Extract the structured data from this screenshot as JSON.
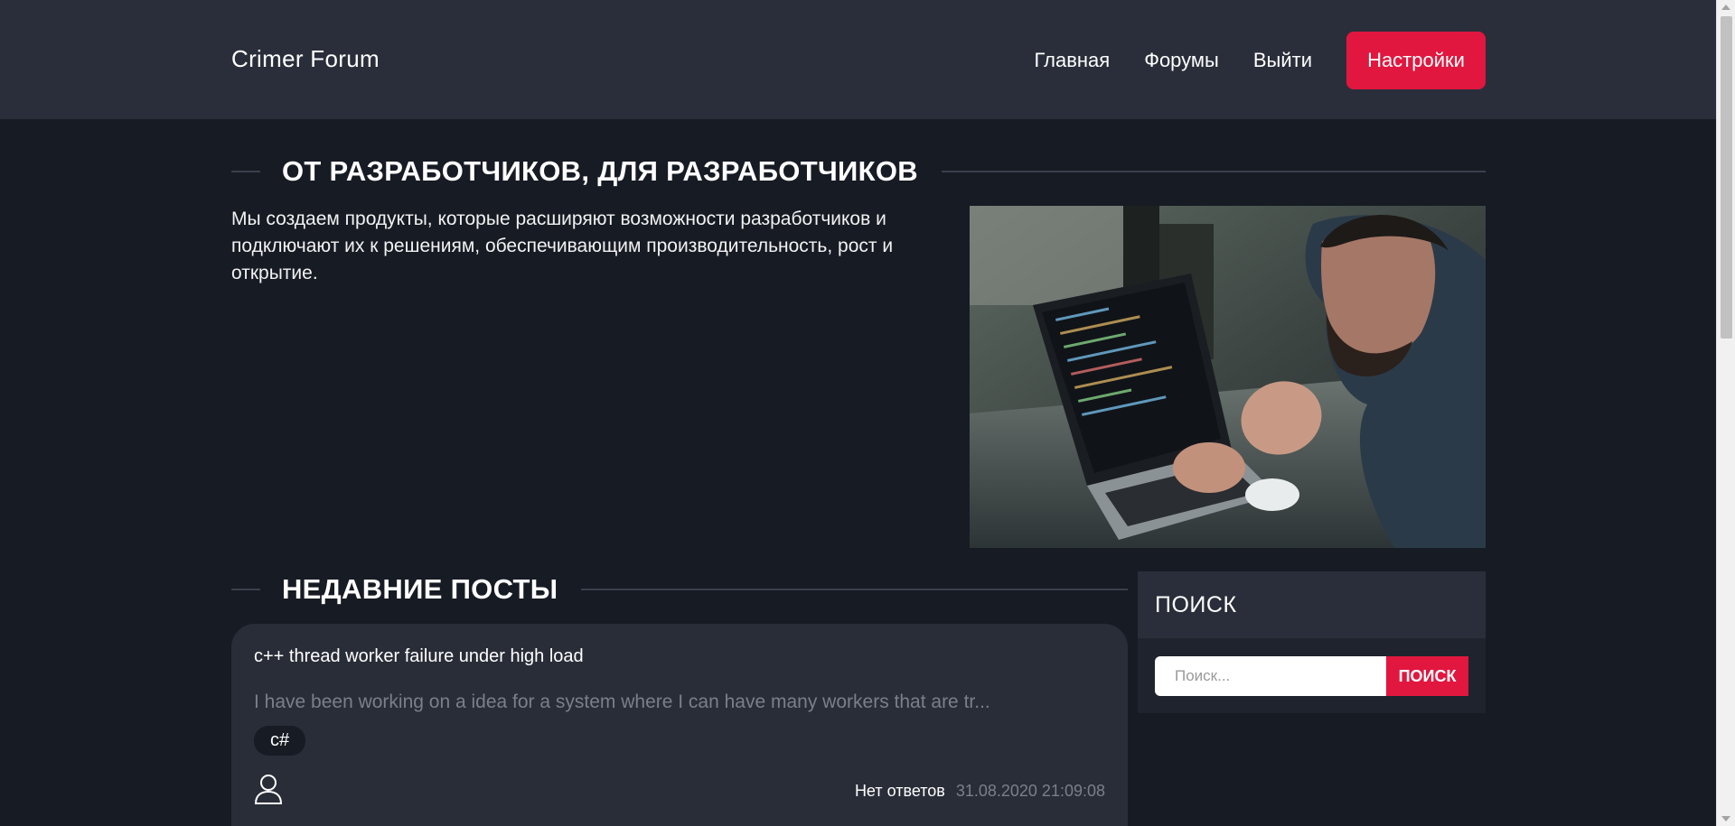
{
  "header": {
    "brand": "Crimer Forum",
    "nav": [
      "Главная",
      "Форумы",
      "Выйти"
    ],
    "settings_label": "Настройки"
  },
  "hero": {
    "title": "ОТ РАЗРАБОТЧИКОВ, ДЛЯ РАЗРАБОТЧИКОВ",
    "text": "Мы создаем продукты, которые расширяют возможности разработчиков и подключают их к решениям, обеспечивающим производительность, рост и открытие."
  },
  "recent": {
    "title": "НЕДАВНИЕ ПОСТЫ",
    "posts": [
      {
        "title": "c++ thread worker failure under high load",
        "excerpt": "I have been working on a idea for a system where I can have many workers that are tr...",
        "tag": "c#",
        "replies": "Нет ответов",
        "date": "31.08.2020 21:09:08"
      }
    ]
  },
  "search": {
    "title": "ПОИСК",
    "placeholder": "Поиск...",
    "button": "ПОИСК"
  },
  "colors": {
    "accent": "#e1173f",
    "background": "#171b24",
    "header": "#2a2e3a",
    "card": "#292d38"
  }
}
